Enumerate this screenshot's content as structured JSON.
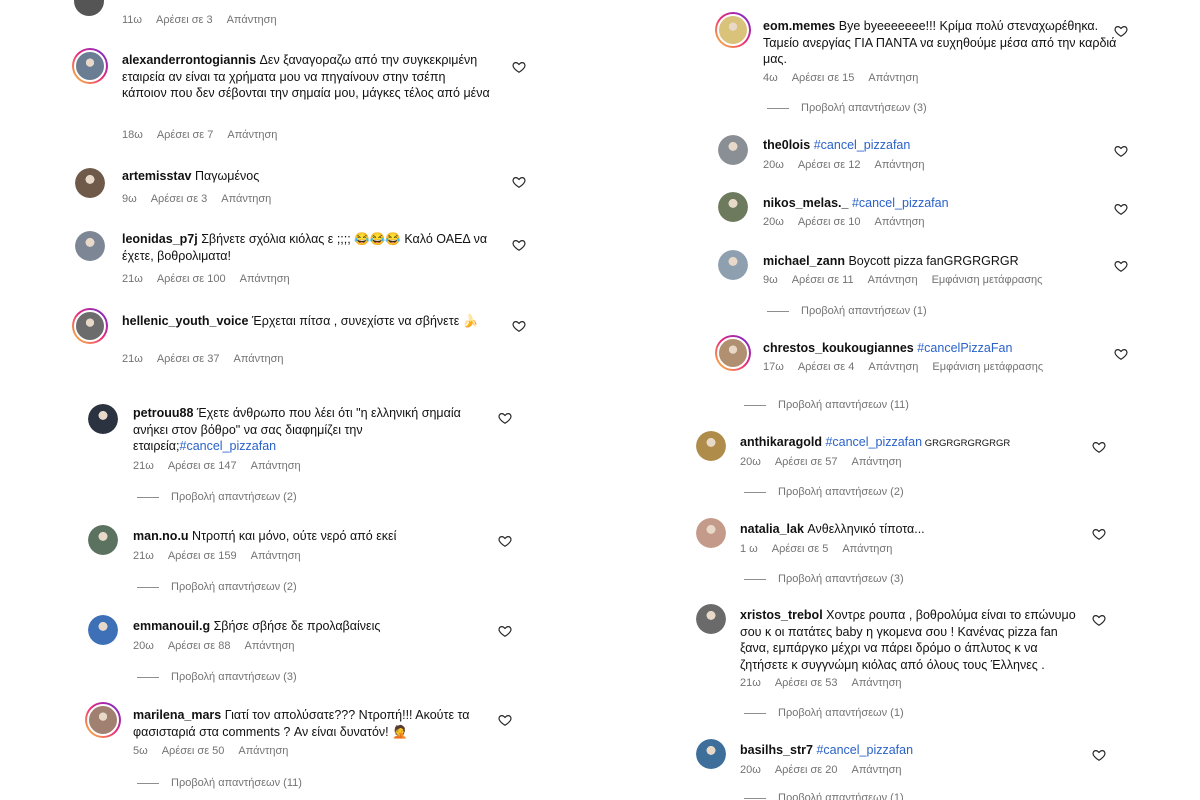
{
  "left": {
    "top_meta": {
      "time": "11ω",
      "likes": "Αρέσει σε 3",
      "reply": "Απάντηση"
    },
    "comments": [
      {
        "user": "alexanderrontogiannis",
        "text": " Δεν ξαναγοραζω από την συγκεκριμένη εταιρεία αν είναι τα χρήματα μου να πηγαίνουν στην τσέπη κάποιον που δεν σέβονται την σημαία μου, μάγκες τέλος από μένα",
        "time": "18ω",
        "likes": "Αρέσει σε 7",
        "reply": "Απάντηση"
      },
      {
        "user": "artemisstav",
        "text": " Παγωμένος",
        "time": "9ω",
        "likes": "Αρέσει σε 3",
        "reply": "Απάντηση"
      },
      {
        "user": "leonidas_p7j",
        "text": " Σβήνετε σχόλια κιόλας ε ;;;; 😂😂😂 Καλό ΟΑΕΔ να έχετε, βοθρολιματα!",
        "time": "21ω",
        "likes": "Αρέσει σε 100",
        "reply": "Απάντηση"
      },
      {
        "user": "hellenic_youth_voice",
        "text": " Έρχεται πίτσα , συνεχίστε να σβήνετε 🍌",
        "time": "21ω",
        "likes": "Αρέσει σε 37",
        "reply": "Απάντηση"
      },
      {
        "user": "petrouu88",
        "text": " Έχετε άνθρωπο που λέει ότι \"η ελληνική σημαία ανήκει στον βόθρο\" να σας διαφημίζει την εταιρεία;",
        "hashtag": "#cancel_pizzafan",
        "time": "21ω",
        "likes": "Αρέσει σε 147",
        "reply": "Απάντηση",
        "view_replies": "Προβολή απαντήσεων (2)"
      },
      {
        "user": "man.no.u",
        "text": " Ντροπή και μόνο, ούτε νερό από εκεί",
        "time": "21ω",
        "likes": "Αρέσει σε 159",
        "reply": "Απάντηση",
        "view_replies": "Προβολή απαντήσεων (2)"
      },
      {
        "user": "emmanouil.g",
        "text": " Σβήσε σβήσε δε προλαβαίνεις",
        "time": "20ω",
        "likes": "Αρέσει σε 88",
        "reply": "Απάντηση",
        "view_replies": "Προβολή απαντήσεων (3)"
      },
      {
        "user": "marilena_mars",
        "text": " Γιατί τον απολύσατε??? Ντροπή!!! Ακούτε τα φασισταριά στα comments ? Αν είναι δυνατόν! 🤦",
        "time": "5ω",
        "likes": "Αρέσει σε 50",
        "reply": "Απάντηση",
        "view_replies": "Προβολή απαντήσεων (11)"
      }
    ]
  },
  "right": {
    "comments": [
      {
        "user": "eom.memes",
        "text": " Bye byeeeeeee!!! Κρίμα πολύ στεναχωρέθηκα. Ταμείο ανεργίας ΓΙΑ ΠΑΝΤΑ να ευχηθούμε μέσα από την καρδιά μας.",
        "time": "4ω",
        "likes": "Αρέσει σε 15",
        "reply": "Απάντηση",
        "view_replies": "Προβολή απαντήσεων (3)"
      },
      {
        "user": "the0lois",
        "text": " ",
        "hashtag": "#cancel_pizzafan",
        "time": "20ω",
        "likes": "Αρέσει σε 12",
        "reply": "Απάντηση"
      },
      {
        "user": "nikos_melas._",
        "text": " ",
        "hashtag": "#cancel_pizzafan",
        "time": "20ω",
        "likes": "Αρέσει σε 10",
        "reply": "Απάντηση"
      },
      {
        "user": "michael_zann",
        "text": " Boycott pizza fanGRGRGRGR",
        "time": "9ω",
        "likes": "Αρέσει σε 11",
        "reply": "Απάντηση",
        "translate": "Εμφάνιση μετάφρασης",
        "view_replies": "Προβολή απαντήσεων (1)"
      },
      {
        "user": "chrestos_koukougiannes",
        "text": " ",
        "hashtag": "#cancelPizzaFan",
        "time": "17ω",
        "likes": "Αρέσει σε 4",
        "reply": "Απάντηση",
        "translate": "Εμφάνιση μετάφρασης"
      },
      {
        "view_replies": "Προβολή απαντήσεων (11)"
      },
      {
        "user": "anthikaragold",
        "text": " ",
        "hashtag": "#cancel_pizzafan",
        "suffix": " GRGRGRGRGRGR",
        "time": "20ω",
        "likes": "Αρέσει σε 57",
        "reply": "Απάντηση",
        "view_replies": "Προβολή απαντήσεων (2)"
      },
      {
        "user": "natalia_lak",
        "text": " Ανθελληνικό τίποτα...",
        "time": "1 ω",
        "likes": "Αρέσει σε 5",
        "reply": "Απάντηση",
        "view_replies": "Προβολή απαντήσεων (3)"
      },
      {
        "user": "xristos_trebol",
        "text": " Χοντρε ρουπα , βοθρολύμα είναι το επώνυμο σου κ οι πατάτες baby η γκομενα σου ! Κανένας pizza fan ξανα, εμπάργκο μέχρι να πάρει δρόμο ο άπλυτος κ να ζητήσετε κ συγγνώμη κιόλας από όλους τους Έλληνες .",
        "time": "21ω",
        "likes": "Αρέσει σε 53",
        "reply": "Απάντηση",
        "view_replies": "Προβολή απαντήσεων (1)"
      },
      {
        "user": "basilhs_str7",
        "text": " ",
        "hashtag": "#cancel_pizzafan",
        "time": "20ω",
        "likes": "Αρέσει σε 20",
        "reply": "Απάντηση",
        "view_replies": "Προβολή απαντήσεων (1)"
      }
    ]
  },
  "colors": {
    "hashtag": "#2a62c9",
    "meta": "#737373",
    "text": "#111111"
  },
  "icons": {
    "like": "heart-outline-icon"
  }
}
